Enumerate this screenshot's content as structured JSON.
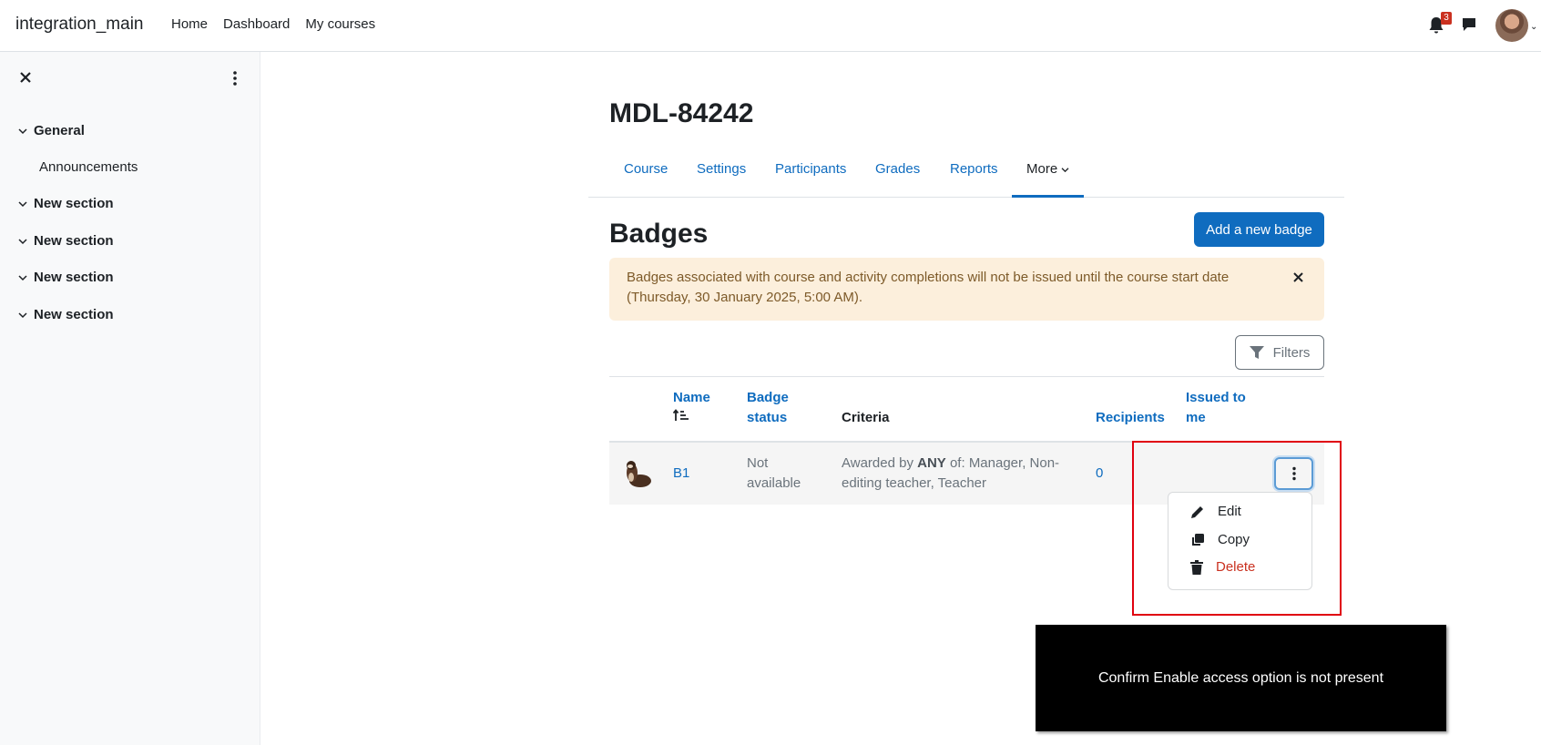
{
  "navbar": {
    "brand": "integration_main",
    "links": [
      "Home",
      "Dashboard",
      "My courses"
    ],
    "notification_count": "3"
  },
  "drawer": {
    "sections": [
      {
        "label": "General",
        "items": [
          "Announcements"
        ]
      },
      {
        "label": "New section"
      },
      {
        "label": "New section"
      },
      {
        "label": "New section"
      },
      {
        "label": "New section"
      }
    ]
  },
  "course": {
    "title": "MDL-84242",
    "tabs": [
      "Course",
      "Settings",
      "Participants",
      "Grades",
      "Reports",
      "More"
    ],
    "active_tab": "More"
  },
  "badges": {
    "heading": "Badges",
    "add_button": "Add a new badge",
    "alert": "Badges associated with course and activity completions will not be issued until the course start date (Thursday, 30 January 2025, 5:00 AM).",
    "filters_label": "Filters",
    "columns": {
      "name": "Name",
      "status": "Badge status",
      "criteria": "Criteria",
      "recipients": "Recipients",
      "issued": "Issued to me"
    },
    "rows": [
      {
        "name": "B1",
        "status": "Not available",
        "criteria_prefix": "Awarded by",
        "criteria_strong": "ANY",
        "criteria_suffix": "of: Manager, Non-editing teacher, Teacher",
        "recipients": "0"
      }
    ],
    "action_menu": [
      "Edit",
      "Copy",
      "Delete"
    ]
  },
  "annotation": "Confirm Enable access option is not present",
  "colors": {
    "primary": "#0f6cbf",
    "alert_bg": "#fcefdc",
    "danger": "#ca3120",
    "highlight": "#e0000f"
  }
}
